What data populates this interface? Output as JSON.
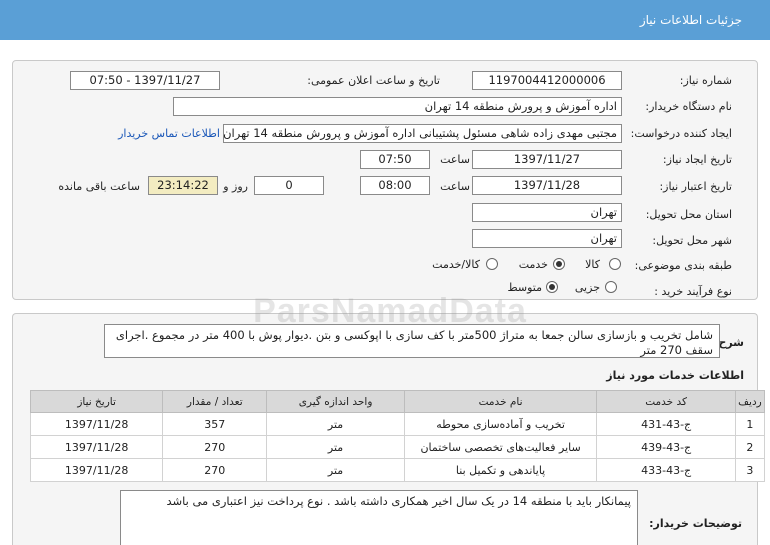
{
  "header": {
    "title": "جزئیات اطلاعات نیاز"
  },
  "labels": {
    "need_number": "شماره نیاز:",
    "announce_datetime": "تاریخ و ساعت اعلان عمومی:",
    "buyer_org": "نام دستگاه خریدار:",
    "requester": "ایجاد کننده درخواست:",
    "need_created": "تاریخ ایجاد نیاز:",
    "need_validity": "تاریخ اعتبار نیاز:",
    "time": "ساعت",
    "day_and": "روز و",
    "remaining": "ساعت باقی مانده",
    "province": "استان محل تحویل:",
    "city": "شهر محل تحویل:",
    "category": "طبقه بندی موضوعی:",
    "purchase_type": "نوع فرآیند خرید :",
    "general_desc": "شرح کلی نیاز:",
    "services_title": "اطلاعات خدمات مورد نیاز",
    "buyer_notes": "توضیحات خریدار:"
  },
  "fields": {
    "need_number": "1197004412000006",
    "announce_datetime": "1397/11/27 - 07:50",
    "buyer_org": "اداره آموزش و پرورش منطقه 14 تهران",
    "requester": "مجتبی مهدی زاده شاهی مسئول پشتیبانی اداره آموزش و پرورش منطقه 14 تهران",
    "contact_link": "اطلاعات تماس خریدار",
    "created_date": "1397/11/27",
    "created_time": "07:50",
    "validity_date": "1397/11/28",
    "validity_time": "08:00",
    "days": "0",
    "remaining_time": "23:14:22",
    "province": "تهران",
    "city": "تهران"
  },
  "category_options": [
    {
      "label": "کالا",
      "selected": false
    },
    {
      "label": "خدمت",
      "selected": true
    },
    {
      "label": "کالا/خدمت",
      "selected": false
    }
  ],
  "purchase_options": [
    {
      "label": "جزیی",
      "selected": false
    },
    {
      "label": "متوسط",
      "selected": true
    }
  ],
  "general_description": "شامل تخریب و بازسازی سالن جمعا به متراژ 500متر با کف سازی با اپوکسی و بتن .دیوار پوش با 400 متر در مجموع .اجرای سقف 270 متر",
  "table": {
    "headers": [
      "ردیف",
      "کد خدمت",
      "نام خدمت",
      "واحد اندازه گیری",
      "تعداد / مقدار",
      "تاریخ نیاز"
    ],
    "rows": [
      [
        "1",
        "ج-43-431",
        "تخریب و آماده‌سازی محوطه",
        "متر",
        "357",
        "1397/11/28"
      ],
      [
        "2",
        "ج-43-439",
        "سایر فعالیت‌های تخصصی ساختمان",
        "متر",
        "270",
        "1397/11/28"
      ],
      [
        "3",
        "ج-43-433",
        "پایاندهی و تکمیل بنا",
        "متر",
        "270",
        "1397/11/28"
      ]
    ]
  },
  "buyer_notes": "پیمانکار باید با منطقه 14 در یک سال اخیر همکاری داشته باشد . نوع پرداخت نیز اعتباری می باشد",
  "watermark": "ParsNamadData"
}
